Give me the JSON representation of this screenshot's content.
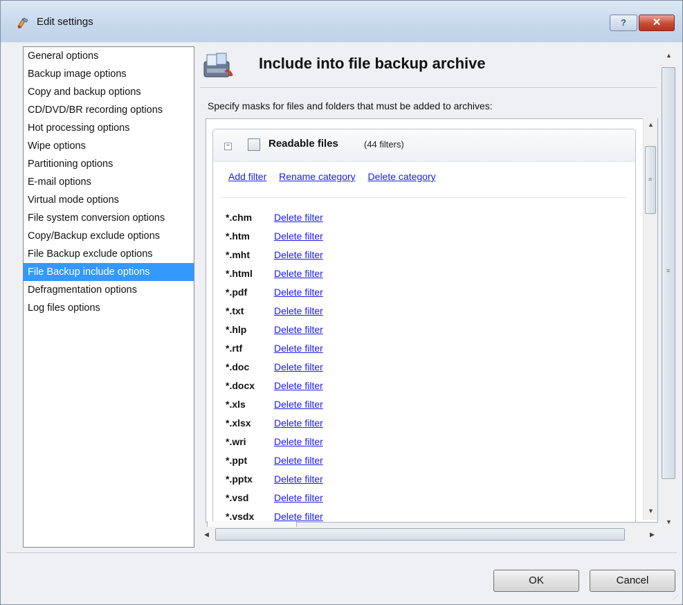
{
  "window": {
    "title": "Edit settings",
    "help_label": "?",
    "close_label": "✕"
  },
  "sidebar": {
    "items": [
      {
        "label": "General options",
        "selected": false
      },
      {
        "label": "Backup image options",
        "selected": false
      },
      {
        "label": "Copy and backup options",
        "selected": false
      },
      {
        "label": "CD/DVD/BR recording options",
        "selected": false
      },
      {
        "label": "Hot processing options",
        "selected": false
      },
      {
        "label": "Wipe options",
        "selected": false
      },
      {
        "label": "Partitioning options",
        "selected": false
      },
      {
        "label": "E-mail options",
        "selected": false
      },
      {
        "label": "Virtual mode options",
        "selected": false
      },
      {
        "label": "File system conversion options",
        "selected": false
      },
      {
        "label": "Copy/Backup exclude options",
        "selected": false
      },
      {
        "label": "File Backup exclude options",
        "selected": false
      },
      {
        "label": "File Backup include options",
        "selected": true
      },
      {
        "label": "Defragmentation options",
        "selected": false
      },
      {
        "label": "Log files options",
        "selected": false
      }
    ]
  },
  "main": {
    "title": "Include into file backup archive",
    "instruction": "Specify masks for files and folders that must be added to archives:",
    "category": {
      "collapse_symbol": "⊟",
      "name": "Readable files",
      "count": "(44 filters)",
      "links": {
        "add": "Add filter",
        "rename": "Rename category",
        "delete": "Delete category"
      },
      "delete_filter_label": "Delete filter",
      "filters": [
        ".chm",
        ".htm",
        ".mht",
        ".html",
        ".pdf",
        ".txt",
        ".hlp",
        ".rtf",
        ".doc",
        ".docx",
        ".xls",
        ".xlsx",
        ".wri",
        ".ppt",
        ".pptx",
        ".vsd",
        ".vsdx"
      ]
    }
  },
  "buttons": {
    "ok": "OK",
    "cancel": "Cancel"
  },
  "colors": {
    "selection": "#3399ff",
    "link": "#1a1aee",
    "close_button": "#c74a35"
  },
  "icons": {
    "title": "settings-tools-icon",
    "header": "file-backup-include-icon"
  }
}
